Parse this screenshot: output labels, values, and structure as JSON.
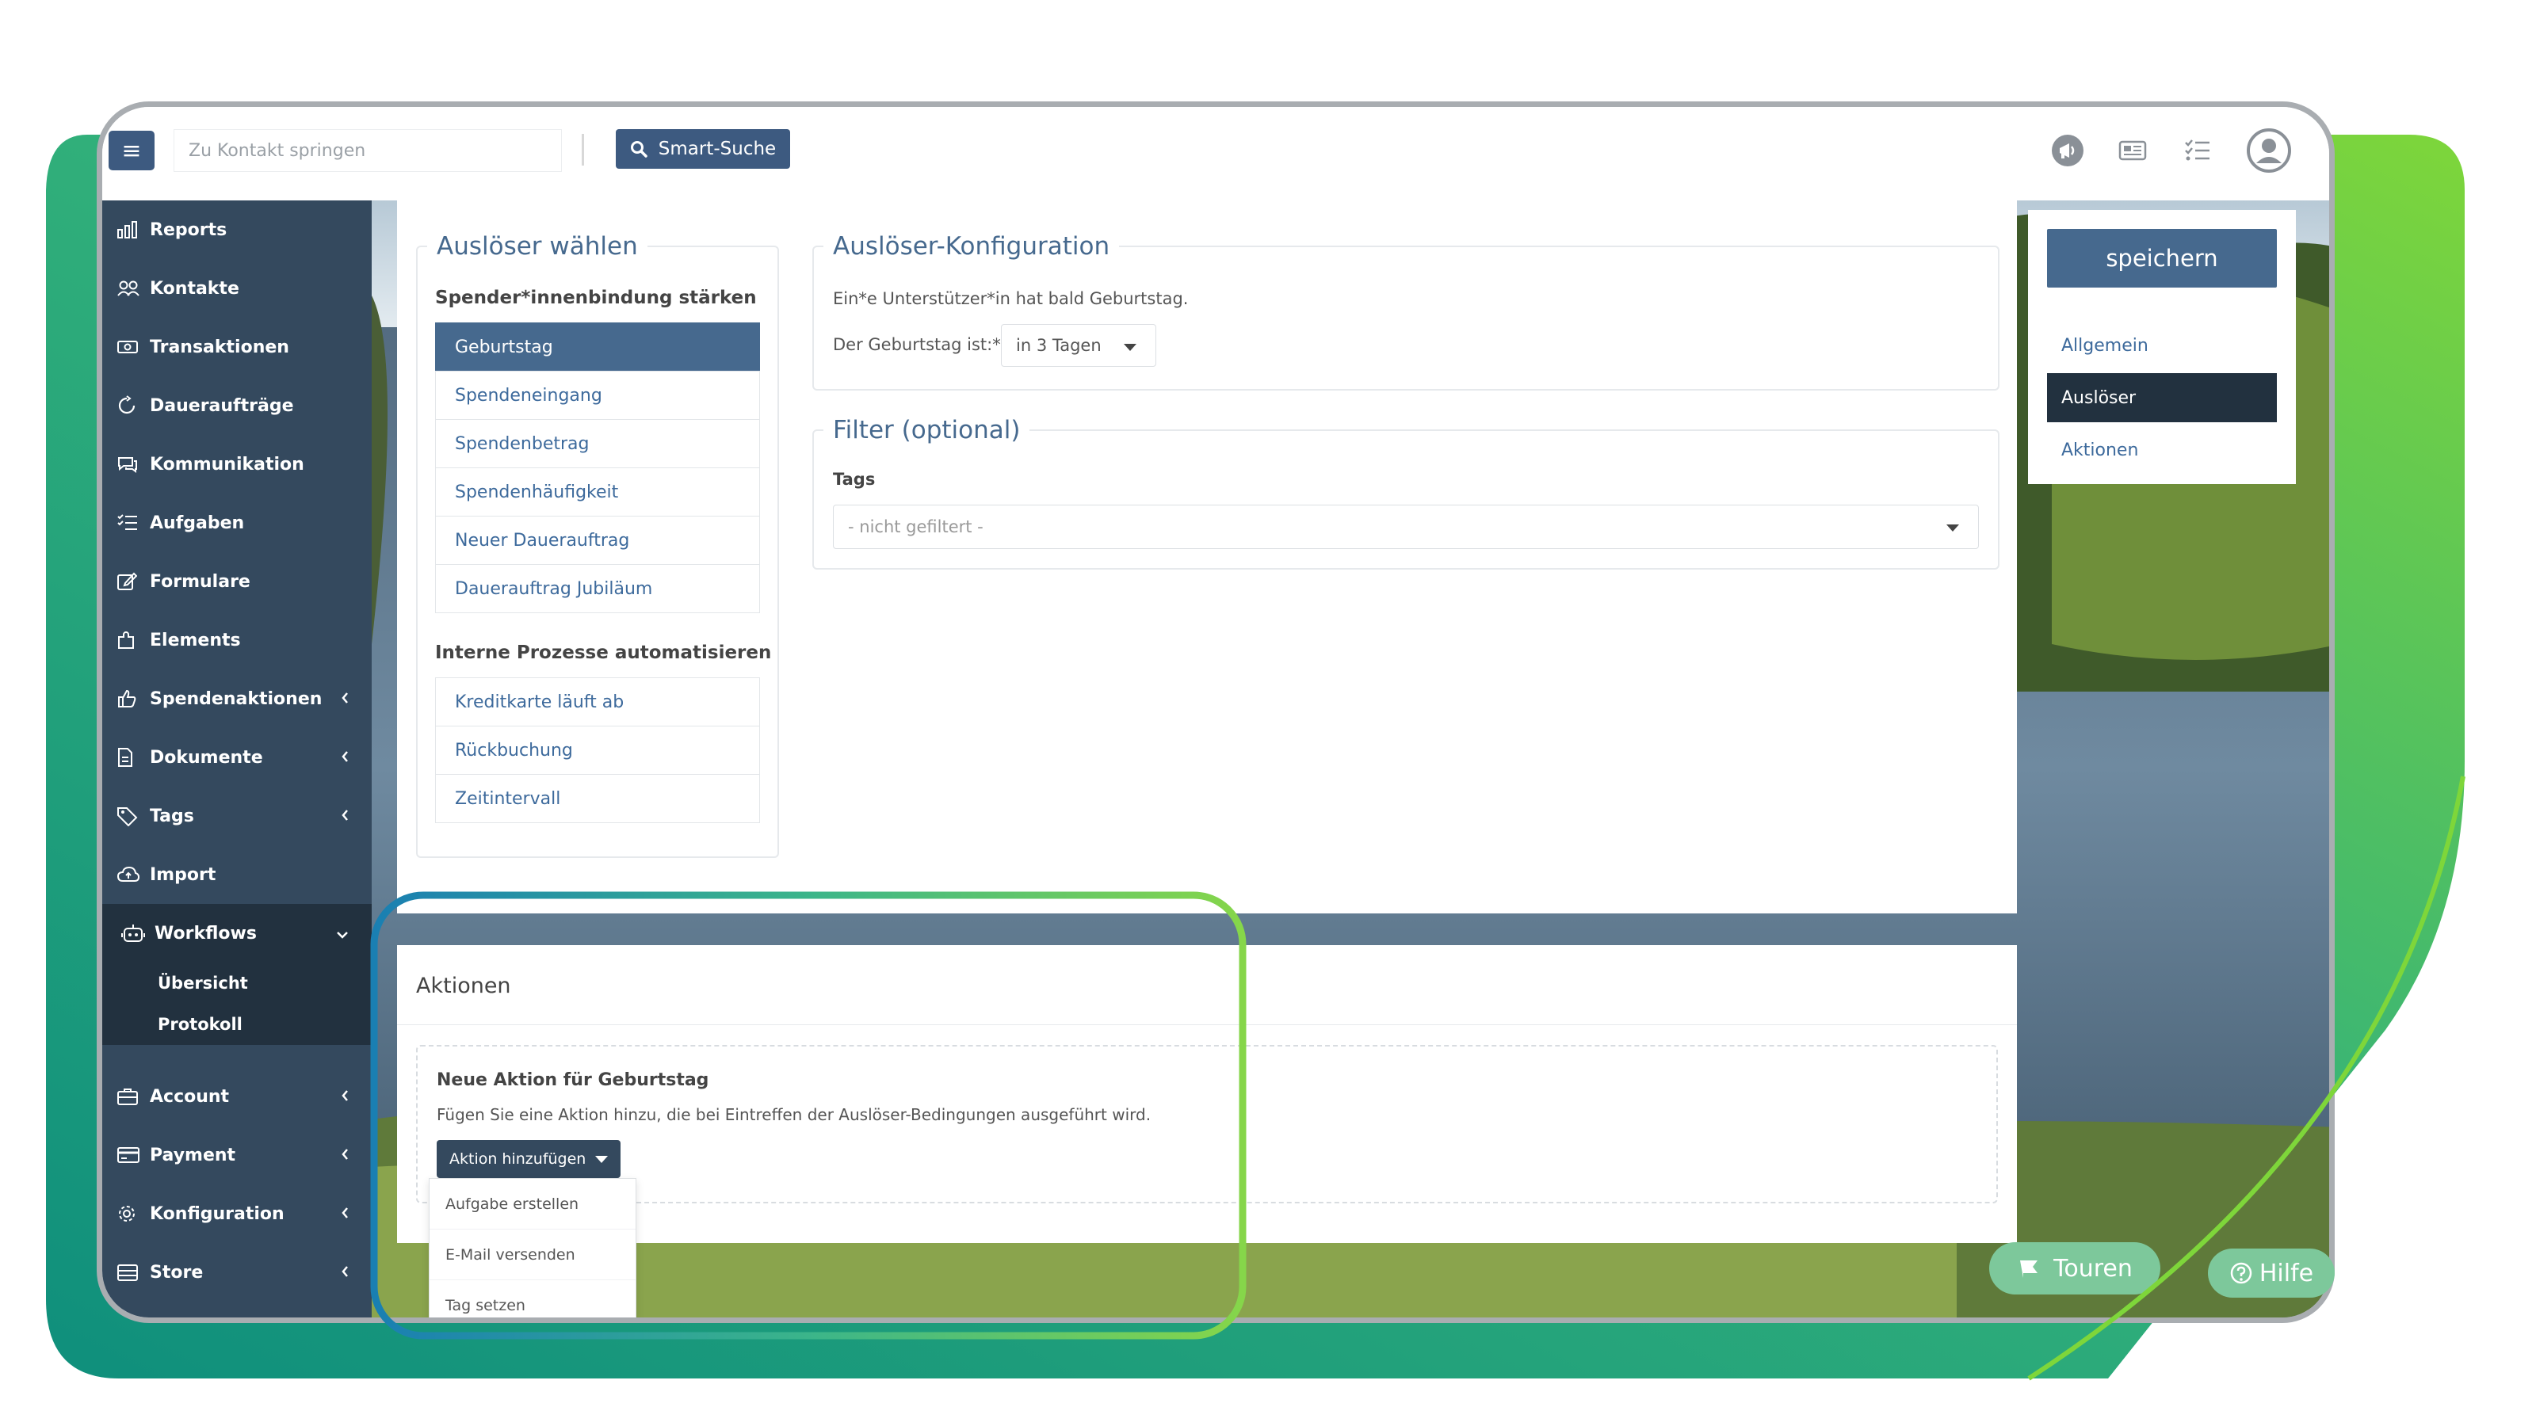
{
  "topbar": {
    "contact_placeholder": "Zu Kontakt springen",
    "smart_search_label": "Smart-Suche"
  },
  "sidebar": {
    "items": [
      {
        "label": "Reports"
      },
      {
        "label": "Kontakte"
      },
      {
        "label": "Transaktionen"
      },
      {
        "label": "Daueraufträge"
      },
      {
        "label": "Kommunikation"
      },
      {
        "label": "Aufgaben"
      },
      {
        "label": "Formulare"
      },
      {
        "label": "Elements"
      },
      {
        "label": "Spendenaktionen"
      },
      {
        "label": "Dokumente"
      },
      {
        "label": "Tags"
      },
      {
        "label": "Import"
      },
      {
        "label": "Workflows"
      },
      {
        "label": "Account"
      },
      {
        "label": "Payment"
      },
      {
        "label": "Konfiguration"
      },
      {
        "label": "Store"
      }
    ],
    "workflows_sub": [
      "Übersicht",
      "Protokoll"
    ]
  },
  "trigger": {
    "legend": "Auslöser wählen",
    "group1_title": "Spender*innenbindung stärken",
    "group1_items": [
      "Geburtstag",
      "Spendeneingang",
      "Spendenbetrag",
      "Spendenhäufigkeit",
      "Neuer Dauerauftrag",
      "Dauerauftrag Jubiläum"
    ],
    "group2_title": "Interne Prozesse automatisieren",
    "group2_items": [
      "Kreditkarte läuft ab",
      "Rückbuchung",
      "Zeitintervall"
    ]
  },
  "config": {
    "legend": "Auslöser-Konfiguration",
    "description": "Ein*e Unterstützer*in hat bald Geburtstag.",
    "birthday_label": "Der Geburtstag ist:*",
    "birthday_value": "in 3 Tagen"
  },
  "filter": {
    "legend": "Filter (optional)",
    "tags_label": "Tags",
    "tags_value": "- nicht gefiltert -"
  },
  "rightnav": {
    "save_label": "speichern",
    "items": [
      "Allgemein",
      "Auslöser",
      "Aktionen"
    ]
  },
  "actions": {
    "title": "Aktionen",
    "box_title": "Neue Aktion für Geburtstag",
    "box_desc": "Fügen Sie eine Aktion hinzu, die bei Eintreffen der Auslöser-Bedingungen ausgeführt wird.",
    "add_label": "Aktion hinzufügen",
    "dropdown": [
      "Aufgabe erstellen",
      "E-Mail versenden",
      "Tag setzen"
    ]
  },
  "floating": {
    "touren_label": "Touren",
    "hilfe_label": "Hilfe"
  },
  "colors": {
    "primary": "#46698e",
    "sidebar": "#34495e",
    "sidebar_active": "#22313f",
    "accent_green": "#7dc89b",
    "brand_gradient_start": "#1a9b86",
    "brand_gradient_end": "#7ed63a"
  }
}
